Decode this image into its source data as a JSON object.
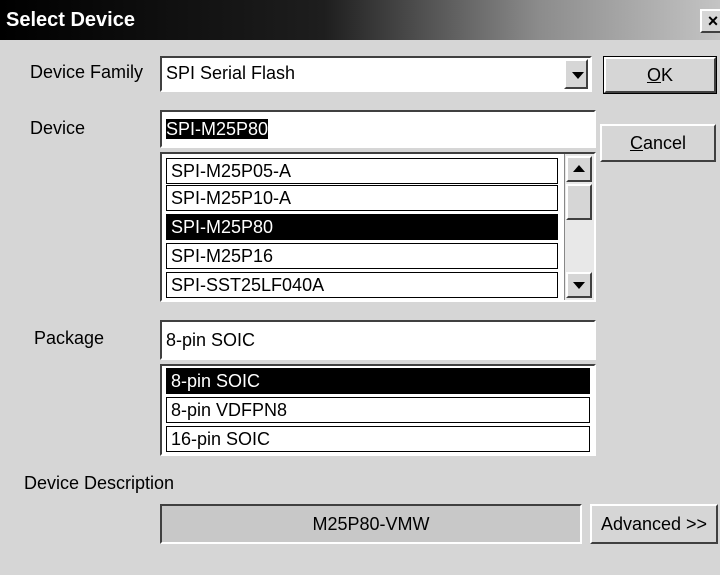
{
  "window": {
    "title": "Select Device",
    "close_label": "×"
  },
  "device_family": {
    "label": "Device Family",
    "value": "SPI Serial Flash"
  },
  "device": {
    "label": "Device",
    "value": "SPI-M25P80",
    "list": [
      "SPI-M25P05-A",
      "SPI-M25P10-A",
      "SPI-M25P80",
      "SPI-M25P16",
      "SPI-SST25LF040A"
    ],
    "selected_index": 2
  },
  "package": {
    "label": "Package",
    "value": "8-pin SOIC",
    "list": [
      "8-pin SOIC",
      "8-pin VDFPN8",
      "16-pin SOIC"
    ],
    "selected_index": 0
  },
  "description": {
    "label": "Device Description",
    "value": "M25P80-VMW"
  },
  "buttons": {
    "ok": {
      "mnemonic": "O",
      "rest": "K"
    },
    "cancel": {
      "mnemonic": "C",
      "rest": "ancel"
    },
    "advanced": "Advanced >>"
  }
}
